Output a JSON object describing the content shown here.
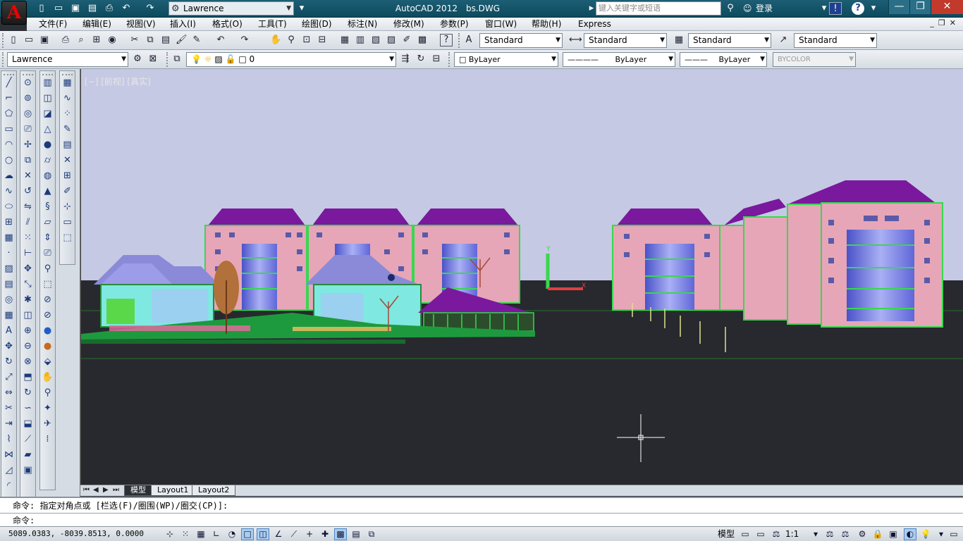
{
  "titlebar": {
    "app_icon": "A",
    "quick_access": [
      "new-icon",
      "open-icon",
      "save-icon",
      "saveas-icon",
      "print-icon",
      "undo-icon",
      "redo-icon"
    ],
    "workspace": "Lawrence",
    "app_name": "AutoCAD 2012",
    "file_name": "bs.DWG",
    "search_placeholder": "键入关键字或短语",
    "login": "登录",
    "window_buttons": [
      "minimize",
      "restore",
      "close"
    ]
  },
  "menubar": {
    "items": [
      "文件(F)",
      "编辑(E)",
      "视图(V)",
      "插入(I)",
      "格式(O)",
      "工具(T)",
      "绘图(D)",
      "标注(N)",
      "修改(M)",
      "参数(P)",
      "窗口(W)",
      "帮助(H)",
      "Express"
    ]
  },
  "toolbar1": {
    "text_style": "Standard",
    "dim_style": "Standard",
    "table_style": "Standard",
    "mleader_style": "Standard"
  },
  "toolbar2": {
    "workspace_combo": "Lawrence",
    "layer": "0",
    "color": "ByLayer",
    "linetype": "ByLayer",
    "lineweight": "ByLayer",
    "plotstyle": "BYCOLOR"
  },
  "viewport": {
    "label": "[−] [前视] [真实]",
    "colors": {
      "sky": "#c6c9e3",
      "ground": "#27292e",
      "roof": "#7a189e",
      "wall": "#e6a6b8",
      "glass": "#7c82e0",
      "trim": "#38d84e"
    }
  },
  "tabs": {
    "items": [
      "模型",
      "Layout1",
      "Layout2"
    ],
    "active": "模型"
  },
  "command": {
    "history": "命令: 指定对角点或 [栏选(F)/圈围(WP)/圈交(CP)]:",
    "prompt": "命令:"
  },
  "status": {
    "coords": "5089.0383,  -8039.8513, 0.0000",
    "model": "模型",
    "scale": "1:1"
  }
}
